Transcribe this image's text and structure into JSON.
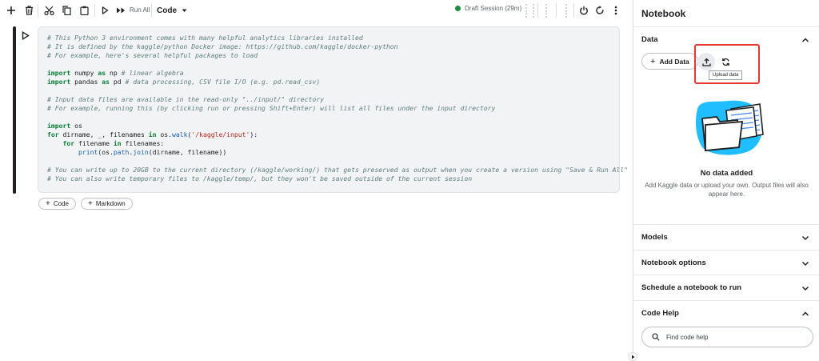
{
  "toolbar": {
    "icons": [
      "add-cell-icon",
      "delete-icon",
      "cut-icon",
      "copy-icon",
      "paste-icon",
      "run-icon",
      "run-all-icon"
    ],
    "run_all_label": "Run All",
    "cell_type": "Code",
    "session_label": "Draft Session (29m)",
    "session_color": "#1e8e3e"
  },
  "cell": {
    "code_lines": [
      [
        {
          "t": "# This Python 3 environment comes with many helpful analytics libraries installed",
          "c": "com"
        }
      ],
      [
        {
          "t": "# It is defined by the kaggle/python Docker image: https://github.com/kaggle/docker-python",
          "c": "com"
        }
      ],
      [
        {
          "t": "# For example, here's several helpful packages to load",
          "c": "com"
        }
      ],
      [],
      [
        {
          "t": "import",
          "c": "kw"
        },
        {
          "t": " numpy "
        },
        {
          "t": "as",
          "c": "kw"
        },
        {
          "t": " np "
        },
        {
          "t": "# linear algebra",
          "c": "com"
        }
      ],
      [
        {
          "t": "import",
          "c": "kw"
        },
        {
          "t": " pandas "
        },
        {
          "t": "as",
          "c": "kw"
        },
        {
          "t": " pd "
        },
        {
          "t": "# data processing, CSV file I/O (e.g. pd.read_csv)",
          "c": "com"
        }
      ],
      [],
      [
        {
          "t": "# Input data files are available in the read-only \"../input/\" directory",
          "c": "com"
        }
      ],
      [
        {
          "t": "# For example, running this (by clicking run or pressing Shift+Enter) will list all files under the input directory",
          "c": "com"
        }
      ],
      [],
      [
        {
          "t": "import",
          "c": "kw"
        },
        {
          "t": " os"
        }
      ],
      [
        {
          "t": "for",
          "c": "kw"
        },
        {
          "t": " dirname, _, filenames "
        },
        {
          "t": "in",
          "c": "kw"
        },
        {
          "t": " os."
        },
        {
          "t": "walk",
          "c": "fn"
        },
        {
          "t": "("
        },
        {
          "t": "'/kaggle/input'",
          "c": "str"
        },
        {
          "t": "):"
        }
      ],
      [
        {
          "t": "    "
        },
        {
          "t": "for",
          "c": "kw"
        },
        {
          "t": " filename "
        },
        {
          "t": "in",
          "c": "kw"
        },
        {
          "t": " filenames:"
        }
      ],
      [
        {
          "t": "        "
        },
        {
          "t": "print",
          "c": "fn"
        },
        {
          "t": "(os."
        },
        {
          "t": "path",
          "c": "fn"
        },
        {
          "t": "."
        },
        {
          "t": "join",
          "c": "fn"
        },
        {
          "t": "(dirname, filename))"
        }
      ],
      [],
      [
        {
          "t": "# You can write up to 20GB to the current directory (/kaggle/working/) that gets preserved as output when you create a version using \"Save & Run All\"",
          "c": "com"
        }
      ],
      [
        {
          "t": "# You can also write temporary files to /kaggle/temp/, but they won't be saved outside of the current session",
          "c": "com"
        }
      ]
    ],
    "add_code_label": "Code",
    "add_markdown_label": "Markdown"
  },
  "panel": {
    "title": "Notebook",
    "data_section": {
      "title": "Data",
      "add_data_label": "Add Data",
      "upload_tooltip": "Upload data",
      "empty_title": "No data added",
      "empty_desc": "Add Kaggle data or upload your own. Output files will also appear here."
    },
    "sections": [
      {
        "title": "Models",
        "expanded": false
      },
      {
        "title": "Notebook options",
        "expanded": false
      },
      {
        "title": "Schedule a notebook to run",
        "expanded": false
      },
      {
        "title": "Code Help",
        "expanded": true
      }
    ],
    "code_help_placeholder": "Find code help",
    "highlight_color": "#e53935"
  }
}
